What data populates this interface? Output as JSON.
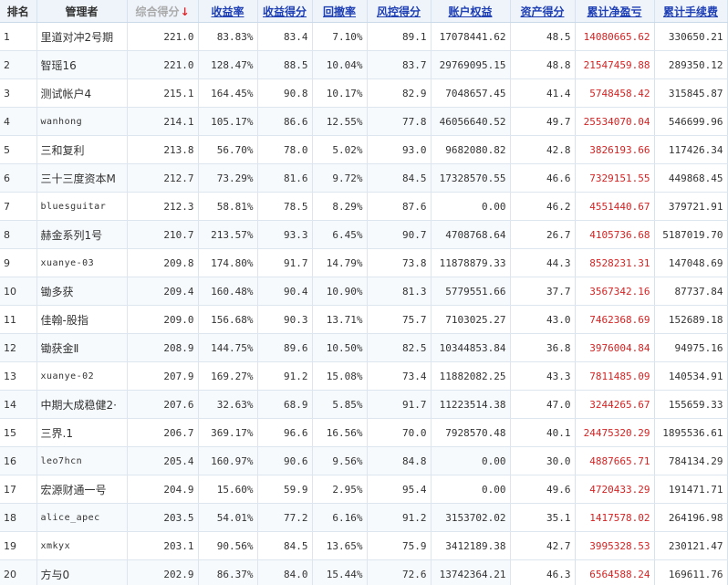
{
  "headers": {
    "rank": "排名",
    "manager": "管理者",
    "total_score": "综合得分",
    "sort_arrow": "↓",
    "return_rate": "收益率",
    "return_score": "收益得分",
    "drawdown": "回撤率",
    "risk_score": "风控得分",
    "equity": "账户权益",
    "asset_score": "资产得分",
    "net_profit": "累计净盈亏",
    "fees": "累计手续费"
  },
  "colors": {
    "header_bg": "#eef4fa",
    "link_blue": "#1f3fb5",
    "profit_red": "#d42323",
    "sort_arrow_red": "#e0262a"
  },
  "rows": [
    {
      "rank": "1",
      "manager": "里道对冲2号期",
      "total_score": "221.0",
      "return_rate": "83.83%",
      "return_score": "83.4",
      "drawdown": "7.10%",
      "risk_score": "89.1",
      "equity": "17078441.62",
      "asset_score": "48.5",
      "net_profit": "14080665.62",
      "fees": "330650.21"
    },
    {
      "rank": "2",
      "manager": "智瑶16",
      "total_score": "221.0",
      "return_rate": "128.47%",
      "return_score": "88.5",
      "drawdown": "10.04%",
      "risk_score": "83.7",
      "equity": "29769095.15",
      "asset_score": "48.8",
      "net_profit": "21547459.88",
      "fees": "289350.12"
    },
    {
      "rank": "3",
      "manager": "测试帐户4",
      "total_score": "215.1",
      "return_rate": "164.45%",
      "return_score": "90.8",
      "drawdown": "10.17%",
      "risk_score": "82.9",
      "equity": "7048657.45",
      "asset_score": "41.4",
      "net_profit": "5748458.42",
      "fees": "315845.87"
    },
    {
      "rank": "4",
      "manager": "wanhong",
      "total_score": "214.1",
      "return_rate": "105.17%",
      "return_score": "86.6",
      "drawdown": "12.55%",
      "risk_score": "77.8",
      "equity": "46056640.52",
      "asset_score": "49.7",
      "net_profit": "25534070.04",
      "fees": "546699.96"
    },
    {
      "rank": "5",
      "manager": "三和复利",
      "total_score": "213.8",
      "return_rate": "56.70%",
      "return_score": "78.0",
      "drawdown": "5.02%",
      "risk_score": "93.0",
      "equity": "9682080.82",
      "asset_score": "42.8",
      "net_profit": "3826193.66",
      "fees": "117426.34"
    },
    {
      "rank": "6",
      "manager": "三十三度资本M",
      "total_score": "212.7",
      "return_rate": "73.29%",
      "return_score": "81.6",
      "drawdown": "9.72%",
      "risk_score": "84.5",
      "equity": "17328570.55",
      "asset_score": "46.6",
      "net_profit": "7329151.55",
      "fees": "449868.45"
    },
    {
      "rank": "7",
      "manager": "bluesguitar",
      "total_score": "212.3",
      "return_rate": "58.81%",
      "return_score": "78.5",
      "drawdown": "8.29%",
      "risk_score": "87.6",
      "equity": "0.00",
      "asset_score": "46.2",
      "net_profit": "4551440.67",
      "fees": "379721.91"
    },
    {
      "rank": "8",
      "manager": "赫金系列1号",
      "total_score": "210.7",
      "return_rate": "213.57%",
      "return_score": "93.3",
      "drawdown": "6.45%",
      "risk_score": "90.7",
      "equity": "4708768.64",
      "asset_score": "26.7",
      "net_profit": "4105736.68",
      "fees": "5187019.70"
    },
    {
      "rank": "9",
      "manager": "xuanye-03",
      "total_score": "209.8",
      "return_rate": "174.80%",
      "return_score": "91.7",
      "drawdown": "14.79%",
      "risk_score": "73.8",
      "equity": "11878879.33",
      "asset_score": "44.3",
      "net_profit": "8528231.31",
      "fees": "147048.69"
    },
    {
      "rank": "10",
      "manager": "锄多获",
      "total_score": "209.4",
      "return_rate": "160.48%",
      "return_score": "90.4",
      "drawdown": "10.90%",
      "risk_score": "81.3",
      "equity": "5779551.66",
      "asset_score": "37.7",
      "net_profit": "3567342.16",
      "fees": "87737.84"
    },
    {
      "rank": "11",
      "manager": "佳翰-股指",
      "total_score": "209.0",
      "return_rate": "156.68%",
      "return_score": "90.3",
      "drawdown": "13.71%",
      "risk_score": "75.7",
      "equity": "7103025.27",
      "asset_score": "43.0",
      "net_profit": "7462368.69",
      "fees": "152689.18"
    },
    {
      "rank": "12",
      "manager": "锄获金Ⅱ",
      "total_score": "208.9",
      "return_rate": "144.75%",
      "return_score": "89.6",
      "drawdown": "10.50%",
      "risk_score": "82.5",
      "equity": "10344853.84",
      "asset_score": "36.8",
      "net_profit": "3976004.84",
      "fees": "94975.16"
    },
    {
      "rank": "13",
      "manager": "xuanye-02",
      "total_score": "207.9",
      "return_rate": "169.27%",
      "return_score": "91.2",
      "drawdown": "15.08%",
      "risk_score": "73.4",
      "equity": "11882082.25",
      "asset_score": "43.3",
      "net_profit": "7811485.09",
      "fees": "140534.91"
    },
    {
      "rank": "14",
      "manager": "中期大成稳健2·",
      "total_score": "207.6",
      "return_rate": "32.63%",
      "return_score": "68.9",
      "drawdown": "5.85%",
      "risk_score": "91.7",
      "equity": "11223514.38",
      "asset_score": "47.0",
      "net_profit": "3244265.67",
      "fees": "155659.33"
    },
    {
      "rank": "15",
      "manager": "三界.1",
      "total_score": "206.7",
      "return_rate": "369.17%",
      "return_score": "96.6",
      "drawdown": "16.56%",
      "risk_score": "70.0",
      "equity": "7928570.48",
      "asset_score": "40.1",
      "net_profit": "24475320.29",
      "fees": "1895536.61"
    },
    {
      "rank": "16",
      "manager": "leo7hcn",
      "total_score": "205.4",
      "return_rate": "160.97%",
      "return_score": "90.6",
      "drawdown": "9.56%",
      "risk_score": "84.8",
      "equity": "0.00",
      "asset_score": "30.0",
      "net_profit": "4887665.71",
      "fees": "784134.29"
    },
    {
      "rank": "17",
      "manager": "宏源财通一号",
      "total_score": "204.9",
      "return_rate": "15.60%",
      "return_score": "59.9",
      "drawdown": "2.95%",
      "risk_score": "95.4",
      "equity": "0.00",
      "asset_score": "49.6",
      "net_profit": "4720433.29",
      "fees": "191471.71"
    },
    {
      "rank": "18",
      "manager": "alice_apec",
      "total_score": "203.5",
      "return_rate": "54.01%",
      "return_score": "77.2",
      "drawdown": "6.16%",
      "risk_score": "91.2",
      "equity": "3153702.02",
      "asset_score": "35.1",
      "net_profit": "1417578.02",
      "fees": "264196.98"
    },
    {
      "rank": "19",
      "manager": "xmkyx",
      "total_score": "203.1",
      "return_rate": "90.56%",
      "return_score": "84.5",
      "drawdown": "13.65%",
      "risk_score": "75.9",
      "equity": "3412189.38",
      "asset_score": "42.7",
      "net_profit": "3995328.53",
      "fees": "230121.47"
    },
    {
      "rank": "20",
      "manager": "方与0",
      "total_score": "202.9",
      "return_rate": "86.37%",
      "return_score": "84.0",
      "drawdown": "15.44%",
      "risk_score": "72.6",
      "equity": "13742364.21",
      "asset_score": "46.3",
      "net_profit": "6564588.24",
      "fees": "169611.76"
    }
  ]
}
